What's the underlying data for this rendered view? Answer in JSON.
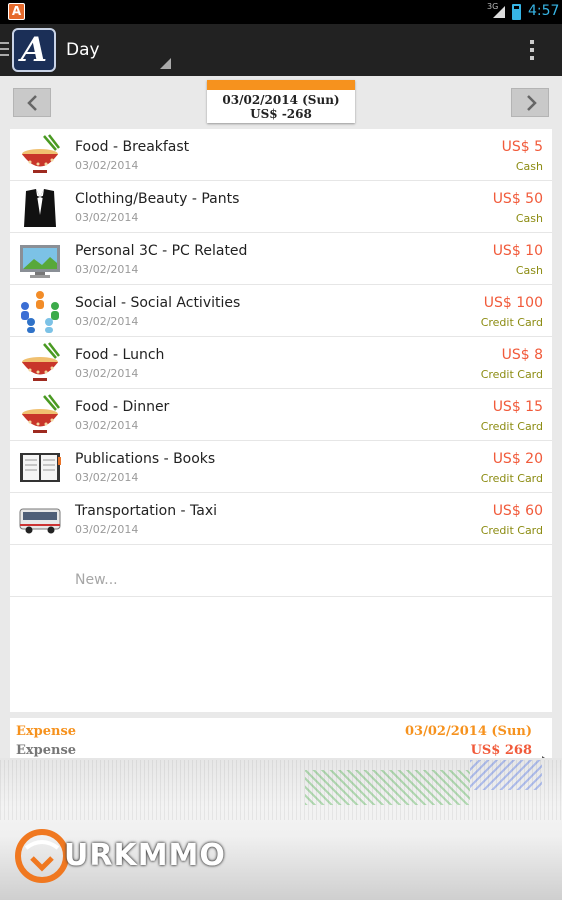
{
  "status_bar": {
    "app_notification": "A",
    "network": "3G",
    "clock": "4:57"
  },
  "action_bar": {
    "title": "Day"
  },
  "date_nav": {
    "date": "03/02/2014 (Sun)",
    "total": "US$ -268"
  },
  "colors": {
    "accent": "#f6921e",
    "amount": "#f15a3a",
    "payment": "#8c8c12"
  },
  "entries": [
    {
      "icon": "noodle-bowl-icon",
      "name": "Food - Breakfast",
      "date": "03/02/2014",
      "amount": "US$ 5",
      "payment": "Cash"
    },
    {
      "icon": "tuxedo-icon",
      "name": "Clothing/Beauty - Pants",
      "date": "03/02/2014",
      "amount": "US$ 50",
      "payment": "Cash"
    },
    {
      "icon": "monitor-icon",
      "name": "Personal 3C - PC Related",
      "date": "03/02/2014",
      "amount": "US$ 10",
      "payment": "Cash"
    },
    {
      "icon": "people-circle-icon",
      "name": "Social - Social Activities",
      "date": "03/02/2014",
      "amount": "US$ 100",
      "payment": "Credit Card"
    },
    {
      "icon": "noodle-bowl-icon",
      "name": "Food - Lunch",
      "date": "03/02/2014",
      "amount": "US$ 8",
      "payment": "Credit Card"
    },
    {
      "icon": "noodle-bowl-icon",
      "name": "Food - Dinner",
      "date": "03/02/2014",
      "amount": "US$ 15",
      "payment": "Credit Card"
    },
    {
      "icon": "book-icon",
      "name": "Publications - Books",
      "date": "03/02/2014",
      "amount": "US$ 20",
      "payment": "Credit Card"
    },
    {
      "icon": "bus-icon",
      "name": "Transportation - Taxi",
      "date": "03/02/2014",
      "amount": "US$ 60",
      "payment": "Credit Card"
    }
  ],
  "new_entry": "New...",
  "summary": {
    "label1": "Expense",
    "date": "03/02/2014 (Sun)",
    "label2": "Expense",
    "total": "US$ 268"
  },
  "watermark": {
    "text": "URKMMO"
  }
}
